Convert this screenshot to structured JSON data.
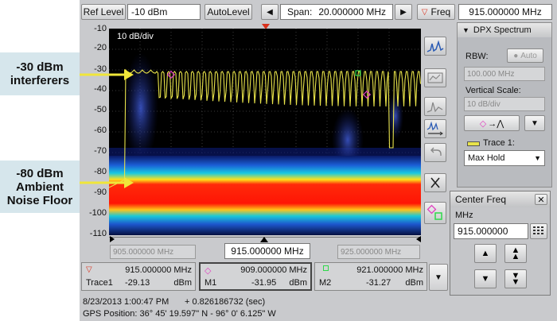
{
  "callouts": {
    "interferers": {
      "line1": "-30 dBm",
      "line2": "interferers"
    },
    "noise": {
      "line1": "-80 dBm",
      "line2": "Ambient",
      "line3": "Noise Floor"
    }
  },
  "toolbar": {
    "ref_level_label": "Ref Level",
    "ref_level_value": "-10 dBm",
    "autolevel_label": "AutoLevel",
    "span_label": "Span:",
    "span_value": "20.000000 MHz",
    "freq_label": "Freq",
    "freq_value": "915.000000 MHz"
  },
  "plot": {
    "scale_label": "10 dB/div",
    "y_ticks": [
      "-10",
      "-20",
      "-30",
      "-40",
      "-50",
      "-60",
      "-70",
      "-80",
      "-90",
      "-100",
      "-110"
    ],
    "x_left": "905.000000 MHz",
    "x_center": "915.000000 MHz",
    "x_right": "925.000000 MHz"
  },
  "side_panel": {
    "title": "DPX Spectrum",
    "rbw_label": "RBW:",
    "rbw_auto": "Auto",
    "rbw_value": "100.000 MHz",
    "vscale_label": "Vertical Scale:",
    "vscale_value": "10 dB/div",
    "trace_label": "Trace 1:",
    "trace_mode": "Max Hold"
  },
  "markers": {
    "trace1": {
      "freq": "915.000000 MHz",
      "name": "Trace1",
      "value": "-29.13",
      "unit": "dBm"
    },
    "m1": {
      "freq": "909.000000 MHz",
      "name": "M1",
      "value": "-31.95",
      "unit": "dBm"
    },
    "m2": {
      "freq": "921.000000 MHz",
      "name": "M2",
      "value": "-31.27",
      "unit": "dBm"
    }
  },
  "center_freq": {
    "title": "Center Freq",
    "unit": "MHz",
    "value": "915.000000"
  },
  "status": {
    "datetime": "8/23/2013 1:00:47 PM",
    "elapsed": "+ 0.826186732 (sec)",
    "gps": "GPS Position: 36° 45' 19.597\" N - 96° 0' 6.125\" W"
  },
  "colors": {
    "trace": "#e8e34a",
    "noise_core": "#ff1a0a",
    "accent_red": "#d9321e",
    "plot_bg": "#000000"
  }
}
